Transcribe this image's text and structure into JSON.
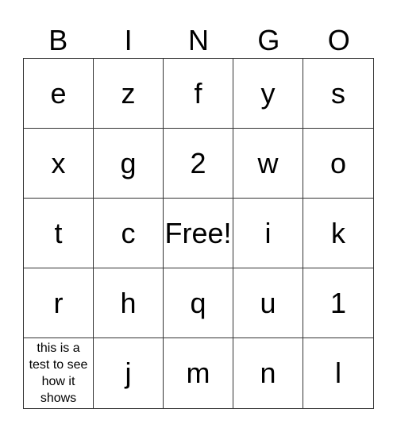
{
  "header": [
    "B",
    "I",
    "N",
    "G",
    "O"
  ],
  "cells": [
    "e",
    "z",
    "f",
    "y",
    "s",
    "x",
    "g",
    "2",
    "w",
    "o",
    "t",
    "c",
    "Free!",
    "i",
    "k",
    "r",
    "h",
    "q",
    "u",
    "1",
    "this is a test to see how it shows",
    "j",
    "m",
    "n",
    "l"
  ]
}
